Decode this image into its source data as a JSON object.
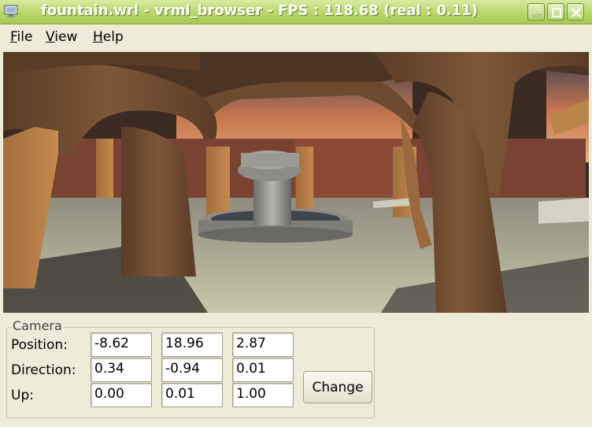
{
  "window": {
    "title": "fountain.wrl - vrml_browser - FPS : 118.68 (real : 0.11)",
    "titlebar_color": "#b7d86a",
    "buttons": [
      "minimize-icon",
      "maximize-icon",
      "close-icon"
    ]
  },
  "menubar": {
    "file": {
      "mnemonic": "F",
      "rest": "ile"
    },
    "view": {
      "mnemonic": "V",
      "rest": "iew"
    },
    "help": {
      "mnemonic": "H",
      "rest": "elp"
    }
  },
  "viewport": {
    "scene": "fountain courtyard with stone arches",
    "colors": {
      "sky": "#d08a5a",
      "wood": "#8a5a34",
      "floor": "#c9c6aa",
      "stone": "#9a9894"
    }
  },
  "camera": {
    "group_title": "Camera",
    "rows": [
      {
        "label": "Position:",
        "values": [
          "-8.62",
          "18.96",
          "2.87"
        ]
      },
      {
        "label": "Direction:",
        "values": [
          "0.34",
          "-0.94",
          "0.01"
        ]
      },
      {
        "label": "Up:",
        "values": [
          "0.00",
          "0.01",
          "1.00"
        ]
      }
    ],
    "change_label": "Change"
  }
}
